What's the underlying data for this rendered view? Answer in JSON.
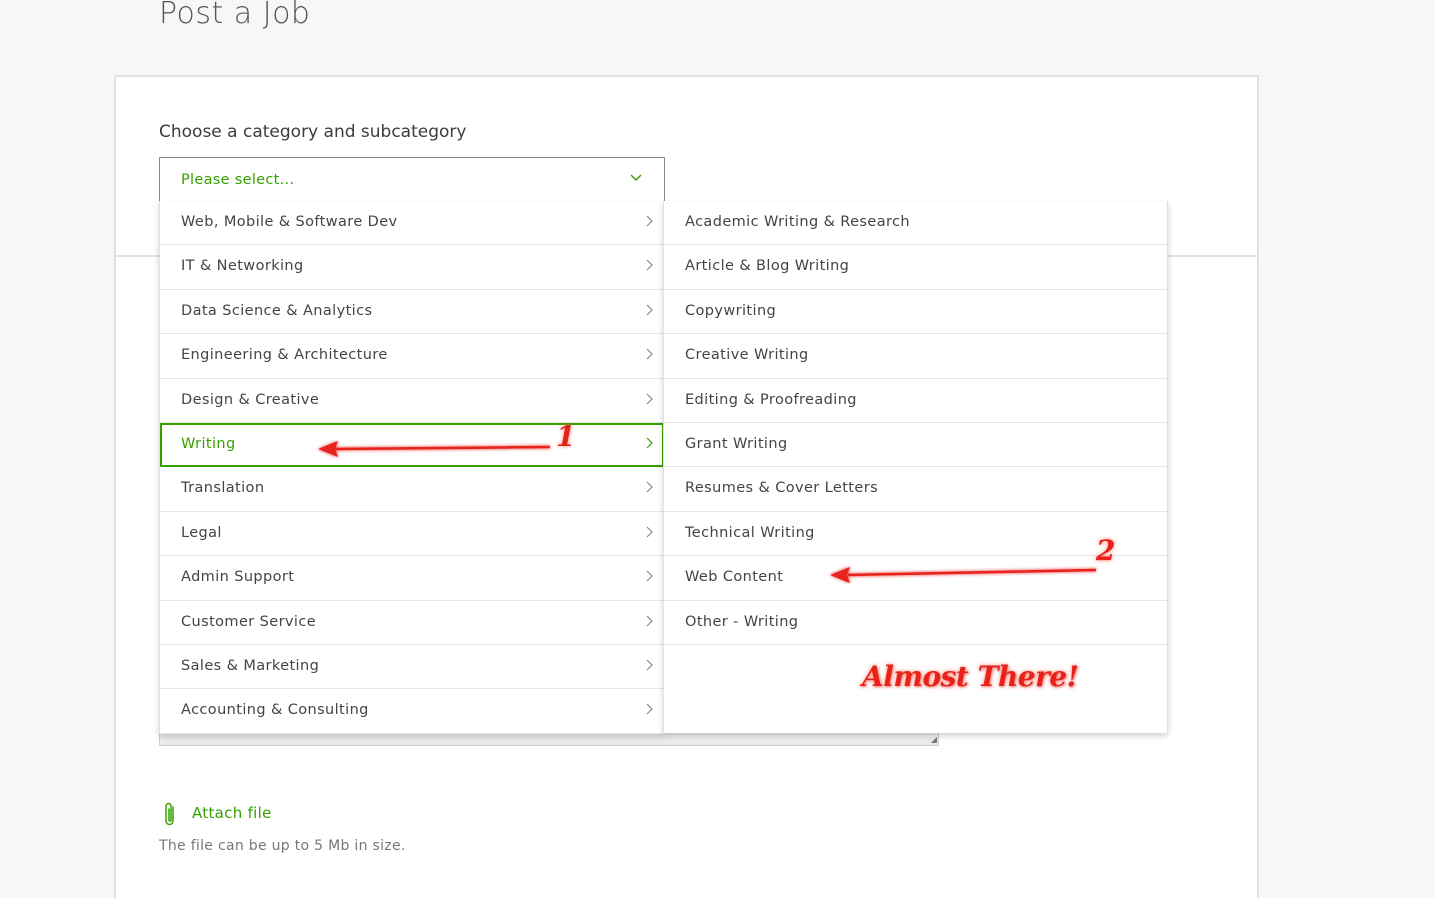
{
  "page": {
    "title": "Post a Job"
  },
  "form": {
    "category_label": "Choose a category and subcategory",
    "select": {
      "placeholder": "Please select..."
    }
  },
  "categories": [
    {
      "label": "Web, Mobile & Software Dev",
      "selected": false
    },
    {
      "label": "IT & Networking",
      "selected": false
    },
    {
      "label": "Data Science & Analytics",
      "selected": false
    },
    {
      "label": "Engineering & Architecture",
      "selected": false
    },
    {
      "label": "Design & Creative",
      "selected": false
    },
    {
      "label": "Writing",
      "selected": true
    },
    {
      "label": "Translation",
      "selected": false
    },
    {
      "label": "Legal",
      "selected": false
    },
    {
      "label": "Admin Support",
      "selected": false
    },
    {
      "label": "Customer Service",
      "selected": false
    },
    {
      "label": "Sales & Marketing",
      "selected": false
    },
    {
      "label": "Accounting & Consulting",
      "selected": false
    }
  ],
  "subcategories": [
    {
      "label": "Academic Writing & Research"
    },
    {
      "label": "Article & Blog Writing"
    },
    {
      "label": "Copywriting"
    },
    {
      "label": "Creative Writing"
    },
    {
      "label": "Editing & Proofreading"
    },
    {
      "label": "Grant Writing"
    },
    {
      "label": "Resumes & Cover Letters"
    },
    {
      "label": "Technical Writing"
    },
    {
      "label": "Web Content"
    },
    {
      "label": "Other - Writing"
    }
  ],
  "annotations": {
    "arrow1_number": "1",
    "arrow2_number": "2",
    "caption": "Almost There!"
  },
  "attachment": {
    "label": "Attach file",
    "hint": "The file can be up to 5 Mb in size."
  },
  "colors": {
    "accent_green": "#37a000",
    "annotation_red": "#e8211a"
  }
}
